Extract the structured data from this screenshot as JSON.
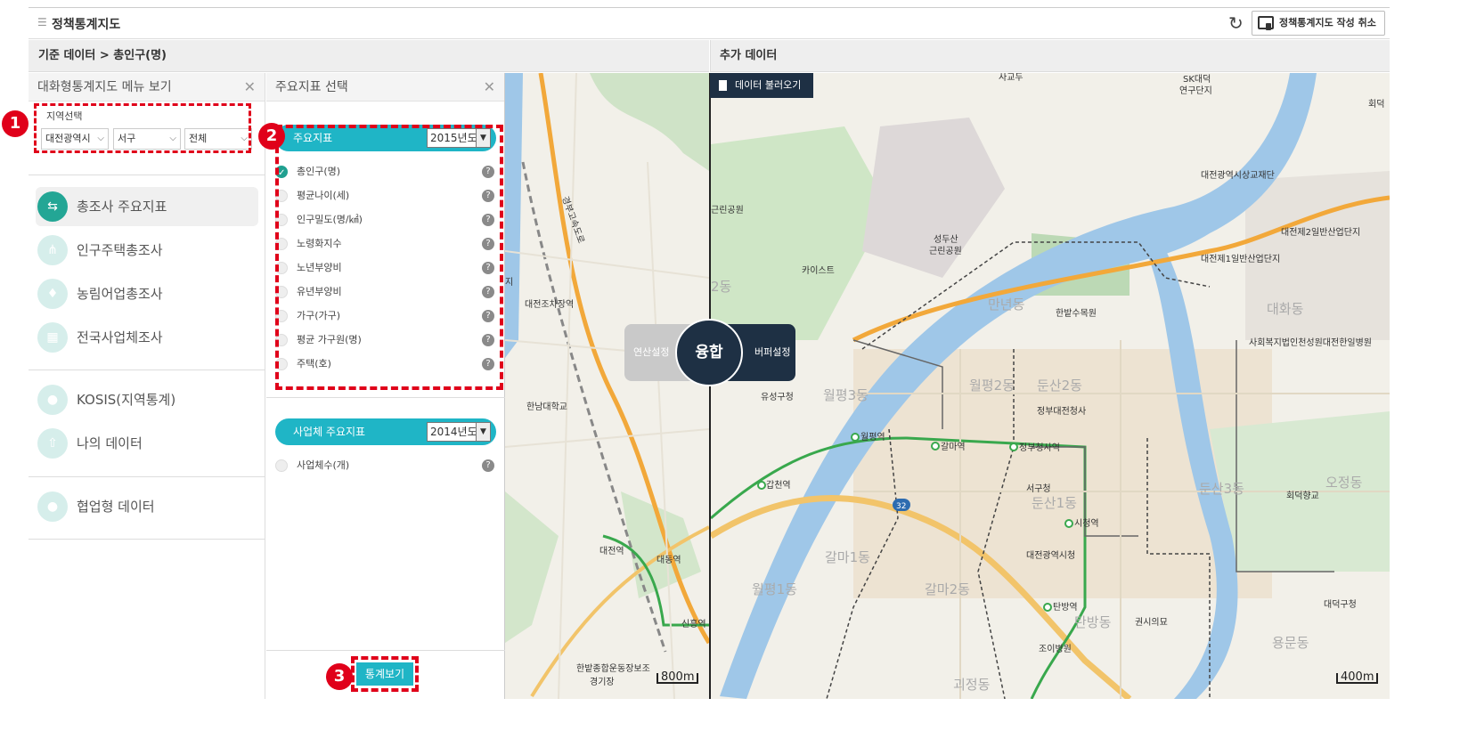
{
  "topbar": {
    "title": "정책통계지도",
    "cancel_label": "정책통계지도 작성 취소"
  },
  "headers": {
    "left": "기준 데이터 > 총인구(명)",
    "right": "추가 데이터"
  },
  "panel1": {
    "title": "대화형통계지도 메뉴 보기",
    "region_label": "지역선택",
    "selects": [
      "대전광역시",
      "서구",
      "전체"
    ],
    "badge": "1",
    "menu": [
      {
        "label": "총조사 주요지표",
        "icon": "signpost-icon",
        "active": true
      },
      {
        "label": "인구주택총조사",
        "icon": "people-icon"
      },
      {
        "label": "농림어업총조사",
        "icon": "farm-icon"
      },
      {
        "label": "전국사업체조사",
        "icon": "building-icon"
      },
      {
        "label": "KOSIS(지역통계)",
        "icon": "korea-map-icon"
      },
      {
        "label": "나의 데이터",
        "icon": "upload-icon"
      },
      {
        "label": "협업형 데이터",
        "icon": "korea-map-icon"
      }
    ]
  },
  "panel2": {
    "title": "주요지표 선택",
    "badge": "2",
    "group1": {
      "label": "주요지표",
      "year": "2015년도"
    },
    "items": [
      "총인구(명)",
      "평균나이(세)",
      "인구밀도(명/㎢)",
      "노령화지수",
      "노년부양비",
      "유년부양비",
      "가구(가구)",
      "평균 가구원(명)",
      "주택(호)"
    ],
    "selected_index": 0,
    "group2": {
      "label": "사업체 주요지표",
      "year": "2014년도"
    },
    "items2": [
      "사업체수(개)"
    ],
    "stat_button": "통계보기",
    "badge3": "3"
  },
  "map_left": {
    "labels": [
      "대전조차장역",
      "한남대학교",
      "대전역",
      "대동역",
      "신흥역",
      "한밭종합운동장보조경기장",
      "경부고속도로",
      "지"
    ],
    "scale": "800m"
  },
  "map_right": {
    "load_button": "데이터 불러오기",
    "labels": [
      "사교두",
      "SK대덕 연구단지",
      "회덕",
      "대전광역시상교재단",
      "대전제2일반산업단지",
      "대전제1일반산업단지",
      "카이스트",
      "성두산 근린공원",
      "근린공원",
      "2동",
      "만년동",
      "한밭수목원",
      "대화동",
      "사회복지법인천성원대전한일병원",
      "유성구청",
      "월평3동",
      "월평2동",
      "둔산2동",
      "정부대전청사",
      "월평역",
      "갈마역",
      "정부청사역",
      "갑천역",
      "서구청",
      "둔산1동",
      "시청역",
      "둔산3동",
      "회덕향교",
      "오정동",
      "대전광역시청",
      "갈마1동",
      "갈마2동",
      "월평1동",
      "탄방역",
      "탄방동",
      "권시의묘",
      "대덕구청",
      "조이병원",
      "괴정동",
      "용문동",
      "32"
    ],
    "scale": "400m"
  },
  "fusion": {
    "left": "연산설정",
    "center": "융합",
    "right": "버퍼설정"
  }
}
